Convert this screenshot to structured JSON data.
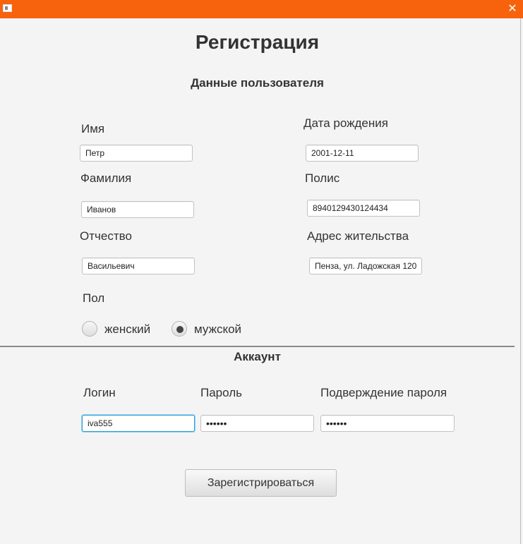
{
  "window": {
    "close_symbol": "✕"
  },
  "title": "Регистрация",
  "user_section": {
    "heading": "Данные пользователя",
    "first_name": {
      "label": "Имя",
      "value": "Петр"
    },
    "birth_date": {
      "label": "Дата рождения",
      "value": "2001-12-11"
    },
    "last_name": {
      "label": "Фамилия",
      "value": "Иванов"
    },
    "policy": {
      "label": "Полис",
      "value": "8940129430124434"
    },
    "patronymic": {
      "label": "Отчество",
      "value": "Васильевич"
    },
    "address": {
      "label": "Адрес жительства",
      "value": "Пенза, ул. Ладожская 120"
    },
    "gender": {
      "label": "Пол",
      "options": [
        "женский",
        "мужской"
      ],
      "selected": "мужской"
    }
  },
  "account_section": {
    "heading": "Аккаунт",
    "login": {
      "label": "Логин",
      "value": "iva555"
    },
    "password": {
      "label": "Пароль",
      "value": "••••••"
    },
    "confirm_password": {
      "label": "Подверждение пароля",
      "value": "••••••"
    }
  },
  "register_button": "Зарегистрироваться",
  "colors": {
    "titlebar": "#f7630c",
    "focus": "#2a9fd6"
  }
}
